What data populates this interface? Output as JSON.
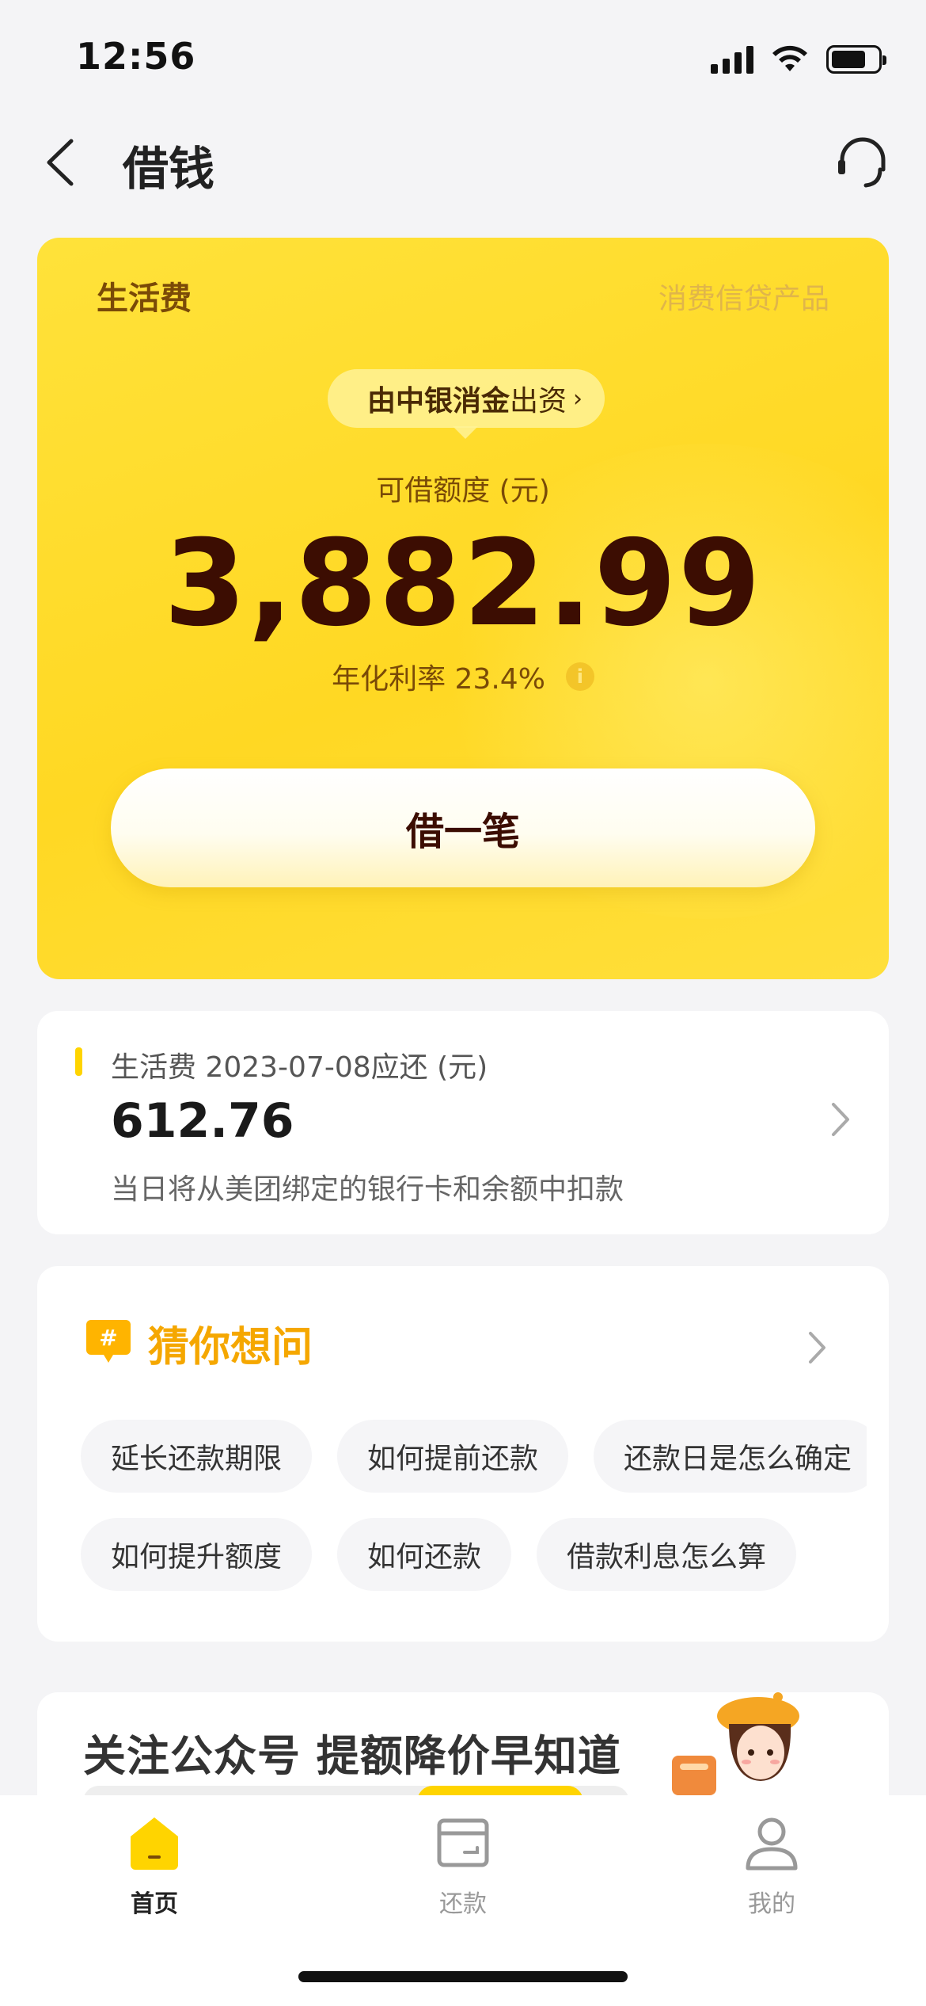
{
  "status_bar": {
    "time": "12:56"
  },
  "nav": {
    "title": "借钱"
  },
  "hero": {
    "product_name": "生活费",
    "product_type": "消费信贷产品",
    "funder_bold": "由中银消金",
    "funder_rest": "出资",
    "limit_label": "可借额度 (元)",
    "limit_amount": "3,882.99",
    "rate_text": "年化利率 23.4%",
    "info_glyph": "i",
    "borrow_label": "借一笔"
  },
  "repayment": {
    "title": "生活费 2023-07-08应还 (元)",
    "amount": "612.76",
    "note": "当日将从美团绑定的银行卡和余额中扣款"
  },
  "guess": {
    "title": "猜你想问",
    "row1": [
      "延长还款期限",
      "如何提前还款",
      "还款日是怎么确定"
    ],
    "row2": [
      "如何提升额度",
      "如何还款",
      "借款利息怎么算"
    ]
  },
  "promo": {
    "title": "关注公众号 提额降价早知道"
  },
  "tabs": [
    {
      "label": "首页",
      "icon": "home-icon",
      "active": true
    },
    {
      "label": "还款",
      "icon": "wallet-icon",
      "active": false
    },
    {
      "label": "我的",
      "icon": "user-icon",
      "active": false
    }
  ],
  "colors": {
    "brand_yellow": "#FFD823",
    "amount_dark": "#3C0D02",
    "accent_orange": "#F5A700"
  }
}
